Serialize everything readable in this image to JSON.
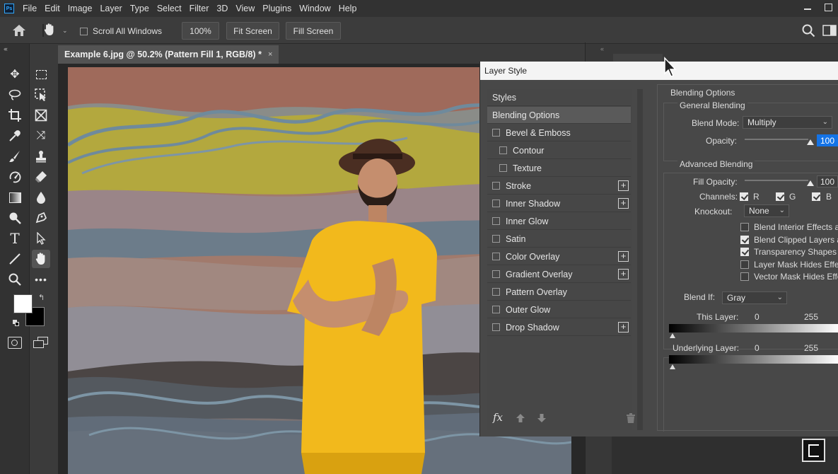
{
  "app": {
    "logo": "Ps"
  },
  "menu": [
    "File",
    "Edit",
    "Image",
    "Layer",
    "Type",
    "Select",
    "Filter",
    "3D",
    "View",
    "Plugins",
    "Window",
    "Help"
  ],
  "options_bar": {
    "scroll_all_windows": "Scroll All Windows",
    "zoom_value": "100%",
    "fit_screen": "Fit Screen",
    "fill_screen": "Fill Screen"
  },
  "document_tab": {
    "title": "Example 6.jpg @ 50.2% (Pattern Fill 1, RGB/8) *",
    "close": "×"
  },
  "tools": [
    "move-icon",
    "marquee-icon",
    "lasso-icon",
    "object-select-icon",
    "crop-icon",
    "frame-icon",
    "eyedropper-icon",
    "content-aware-move-icon",
    "brush-icon",
    "clone-stamp-icon",
    "history-brush-icon",
    "eraser-icon",
    "gradient-icon",
    "blur-icon",
    "dodge-icon",
    "pen-icon",
    "type-icon",
    "path-select-icon",
    "line-icon",
    "hand-icon",
    "zoom-icon",
    "more-icon"
  ],
  "dialog": {
    "title": "Layer Style",
    "styles_list": [
      {
        "label": "Styles",
        "check": false,
        "plus": false,
        "indent": 0,
        "header": true
      },
      {
        "label": "Blending Options",
        "check": false,
        "plus": false,
        "indent": 0,
        "selected": true
      },
      {
        "label": "Bevel & Emboss",
        "check": true,
        "plus": false,
        "indent": 0
      },
      {
        "label": "Contour",
        "check": true,
        "plus": false,
        "indent": 1
      },
      {
        "label": "Texture",
        "check": true,
        "plus": false,
        "indent": 1
      },
      {
        "label": "Stroke",
        "check": true,
        "plus": true,
        "indent": 0
      },
      {
        "label": "Inner Shadow",
        "check": true,
        "plus": true,
        "indent": 0
      },
      {
        "label": "Inner Glow",
        "check": true,
        "plus": false,
        "indent": 0
      },
      {
        "label": "Satin",
        "check": true,
        "plus": false,
        "indent": 0
      },
      {
        "label": "Color Overlay",
        "check": true,
        "plus": true,
        "indent": 0
      },
      {
        "label": "Gradient Overlay",
        "check": true,
        "plus": true,
        "indent": 0
      },
      {
        "label": "Pattern Overlay",
        "check": true,
        "plus": false,
        "indent": 0
      },
      {
        "label": "Outer Glow",
        "check": true,
        "plus": false,
        "indent": 0
      },
      {
        "label": "Drop Shadow",
        "check": true,
        "plus": true,
        "indent": 0
      }
    ],
    "fx_label": "fx",
    "blending_options": {
      "heading": "Blending Options",
      "general_heading": "General Blending",
      "blend_mode_label": "Blend Mode:",
      "blend_mode_value": "Multiply",
      "opacity_label": "Opacity:",
      "opacity_value": "100",
      "advanced_heading": "Advanced Blending",
      "fill_opacity_label": "Fill Opacity:",
      "fill_opacity_value": "100",
      "channels_label": "Channels:",
      "channel_r": "R",
      "channel_g": "G",
      "channel_b": "B",
      "knockout_label": "Knockout:",
      "knockout_value": "None",
      "checks": [
        {
          "label": "Blend Interior Effects as",
          "on": false
        },
        {
          "label": "Blend Clipped Layers as",
          "on": true
        },
        {
          "label": "Transparency Shapes L",
          "on": true
        },
        {
          "label": "Layer Mask Hides Effect",
          "on": false
        },
        {
          "label": "Vector Mask Hides Effe",
          "on": false
        }
      ],
      "blend_if_label": "Blend If:",
      "blend_if_value": "Gray",
      "this_layer_label": "This Layer:",
      "this_layer_min": "0",
      "this_layer_max": "255",
      "underlying_label": "Underlying Layer:",
      "underlying_min": "0",
      "underlying_max": "255"
    }
  },
  "colors": {
    "accent": "#1473e6",
    "shirt": "#f2b91c",
    "panel": "#484848"
  }
}
